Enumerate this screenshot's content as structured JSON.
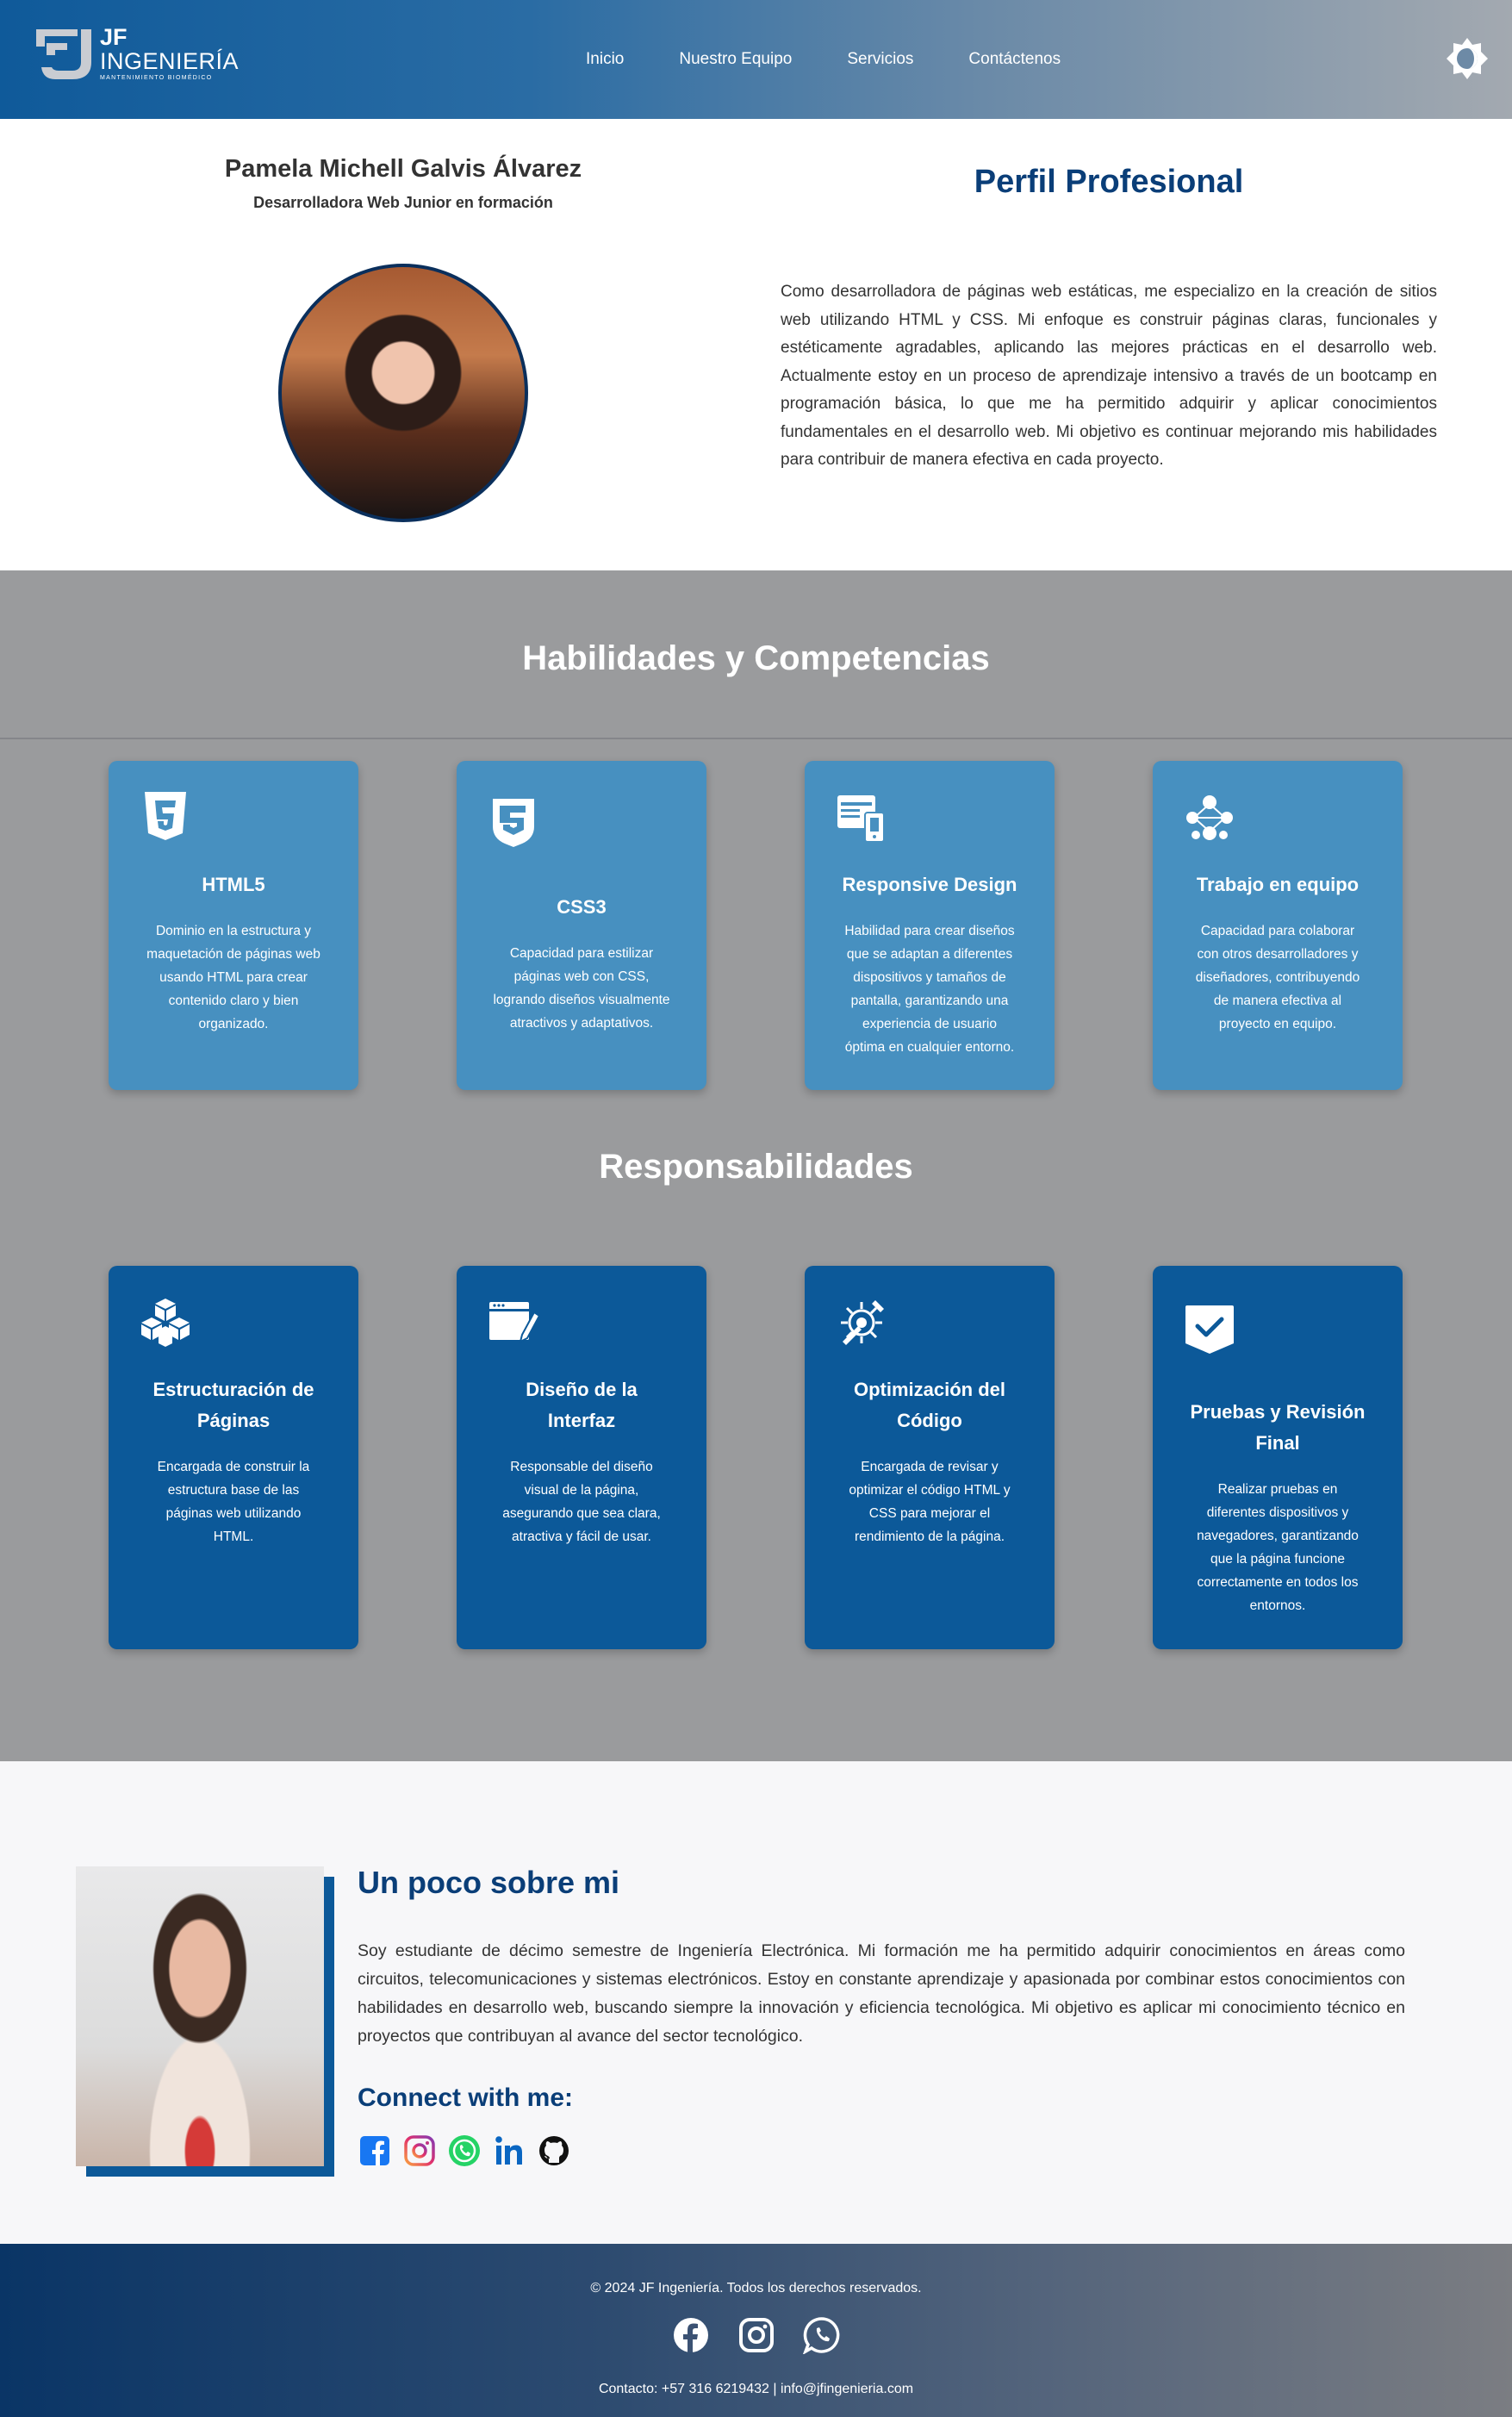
{
  "header": {
    "logo": {
      "line1": "JF",
      "line2": "INGENIERÍA",
      "line3": "MANTENIMIENTO BIOMÉDICO"
    },
    "nav": [
      {
        "label": "Inicio"
      },
      {
        "label": "Nuestro Equipo"
      },
      {
        "label": "Servicios"
      },
      {
        "label": "Contáctenos"
      }
    ],
    "theme_icon": "brightness-contrast-icon"
  },
  "profile": {
    "name": "Pamela Michell Galvis Álvarez",
    "role": "Desarrolladora Web Junior en formación",
    "title": "Perfil Profesional",
    "description": "Como desarrolladora de páginas web estáticas, me especializo en la creación de sitios web utilizando HTML y CSS. Mi enfoque es construir páginas claras, funcionales y estéticamente agradables, aplicando las mejores prácticas en el desarrollo web. Actualmente estoy en un proceso de aprendizaje intensivo a través de un bootcamp en programación básica, lo que me ha permitido adquirir y aplicar conocimientos fundamentales en el desarrollo web. Mi objetivo es continuar mejorando mis habilidades para contribuir de manera efectiva en cada proyecto."
  },
  "skills": {
    "title": "Habilidades y Competencias",
    "cards": [
      {
        "icon": "html5-icon",
        "title": "HTML5",
        "desc": "Dominio en la estructura y maquetación de páginas web usando HTML para crear contenido claro y bien organizado."
      },
      {
        "icon": "css3-icon",
        "title": "CSS3",
        "desc": "Capacidad para estilizar páginas web con CSS, logrando diseños visualmente atractivos y adaptativos."
      },
      {
        "icon": "responsive-devices-icon",
        "title": "Responsive Design",
        "desc": "Habilidad para crear diseños que se adaptan a diferentes dispositivos y tamaños de pantalla, garantizando una experiencia de usuario óptima en cualquier entorno."
      },
      {
        "icon": "team-network-icon",
        "title": "Trabajo en equipo",
        "desc": "Capacidad para colaborar con otros desarrolladores y diseñadores, contribuyendo de manera efectiva al proyecto en equipo."
      }
    ]
  },
  "responsibilities": {
    "title": "Responsabilidades",
    "cards": [
      {
        "icon": "cubes-icon",
        "title": "Estructuración de Páginas",
        "desc": "Encargada de construir la estructura base de las páginas web utilizando HTML."
      },
      {
        "icon": "browser-pencil-icon",
        "title": "Diseño de la Interfaz",
        "desc": "Responsable del diseño visual de la página, asegurando que sea clara, atractiva y fácil de usar."
      },
      {
        "icon": "gear-wrench-icon",
        "title": "Optimización del Código",
        "desc": "Encargada de revisar y optimizar el código HTML y CSS para mejorar el rendimiento de la página."
      },
      {
        "icon": "checkmark-badge-icon",
        "title": "Pruebas y Revisión Final",
        "desc": "Realizar pruebas en diferentes dispositivos y navegadores, garantizando que la página funcione correctamente en todos los entornos."
      }
    ]
  },
  "about": {
    "title": "Un poco sobre mi",
    "text": "Soy estudiante de décimo semestre de Ingeniería Electrónica. Mi formación me ha permitido adquirir conocimientos en áreas como circuitos, telecomunicaciones y sistemas electrónicos. Estoy en constante aprendizaje y apasionada por combinar estos conocimientos con habilidades en desarrollo web, buscando siempre la innovación y eficiencia tecnológica. Mi objetivo es aplicar mi conocimiento técnico en proyectos que contribuyan al avance del sector tecnológico.",
    "connect_title": "Connect with me:",
    "social": [
      "facebook-icon",
      "instagram-icon",
      "whatsapp-icon",
      "linkedin-icon",
      "github-icon"
    ]
  },
  "footer": {
    "copyright": "© 2024 JF Ingeniería. Todos los derechos reservados.",
    "icons": [
      "facebook-icon",
      "instagram-icon",
      "whatsapp-icon"
    ],
    "contact": "Contacto: +57 316 6219432 | info@jfingenieria.com"
  },
  "colors": {
    "primary_dark": "#0a3e78",
    "skill_card": "#4790c0",
    "resp_card": "#0c5999",
    "section_gray": "#9a9b9d"
  }
}
